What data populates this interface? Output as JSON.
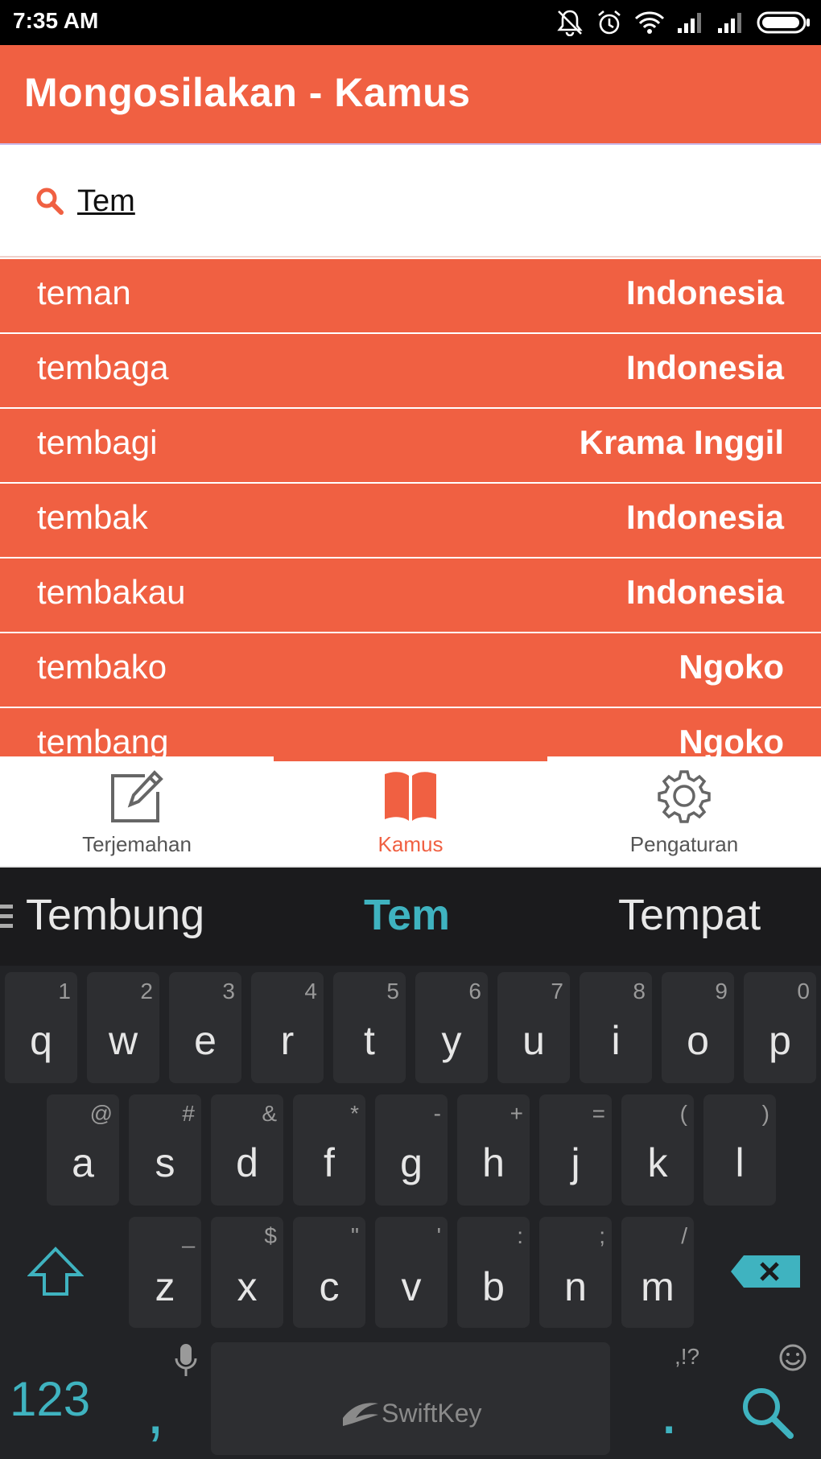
{
  "status": {
    "time": "7:35 AM"
  },
  "app": {
    "title": "Mongosilakan - Kamus"
  },
  "search": {
    "value": "Tem"
  },
  "results": [
    {
      "word": "teman",
      "lang": "Indonesia"
    },
    {
      "word": "tembaga",
      "lang": "Indonesia"
    },
    {
      "word": "tembagi",
      "lang": "Krama Inggil"
    },
    {
      "word": "tembak",
      "lang": "Indonesia"
    },
    {
      "word": "tembakau",
      "lang": "Indonesia"
    },
    {
      "word": "tembako",
      "lang": "Ngoko"
    },
    {
      "word": "tembang",
      "lang": "Ngoko"
    }
  ],
  "nav": {
    "items": [
      {
        "label": "Terjemahan",
        "icon": "edit-icon"
      },
      {
        "label": "Kamus",
        "icon": "book-icon",
        "active": true
      },
      {
        "label": "Pengaturan",
        "icon": "gear-icon"
      }
    ]
  },
  "keyboard": {
    "suggestions": [
      "Tembung",
      "Tem",
      "Tempat"
    ],
    "row1": [
      {
        "k": "q",
        "a": "1"
      },
      {
        "k": "w",
        "a": "2"
      },
      {
        "k": "e",
        "a": "3"
      },
      {
        "k": "r",
        "a": "4"
      },
      {
        "k": "t",
        "a": "5"
      },
      {
        "k": "y",
        "a": "6"
      },
      {
        "k": "u",
        "a": "7"
      },
      {
        "k": "i",
        "a": "8"
      },
      {
        "k": "o",
        "a": "9"
      },
      {
        "k": "p",
        "a": "0"
      }
    ],
    "row2": [
      {
        "k": "a",
        "a": "@"
      },
      {
        "k": "s",
        "a": "#"
      },
      {
        "k": "d",
        "a": "&"
      },
      {
        "k": "f",
        "a": "*"
      },
      {
        "k": "g",
        "a": "-"
      },
      {
        "k": "h",
        "a": "+"
      },
      {
        "k": "j",
        "a": "="
      },
      {
        "k": "k",
        "a": "("
      },
      {
        "k": "l",
        "a": ")"
      }
    ],
    "row3": [
      {
        "k": "z",
        "a": "_"
      },
      {
        "k": "x",
        "a": "$"
      },
      {
        "k": "c",
        "a": "\""
      },
      {
        "k": "v",
        "a": "'"
      },
      {
        "k": "b",
        "a": ":"
      },
      {
        "k": "n",
        "a": ";"
      },
      {
        "k": "m",
        "a": "/"
      }
    ],
    "numbers_label": "123",
    "comma": ",",
    "space_brand": "SwiftKey",
    "period": ".",
    "period_alt": ",!?"
  },
  "colors": {
    "accent": "#f06042",
    "keyboard_accent": "#3fb3c0"
  }
}
